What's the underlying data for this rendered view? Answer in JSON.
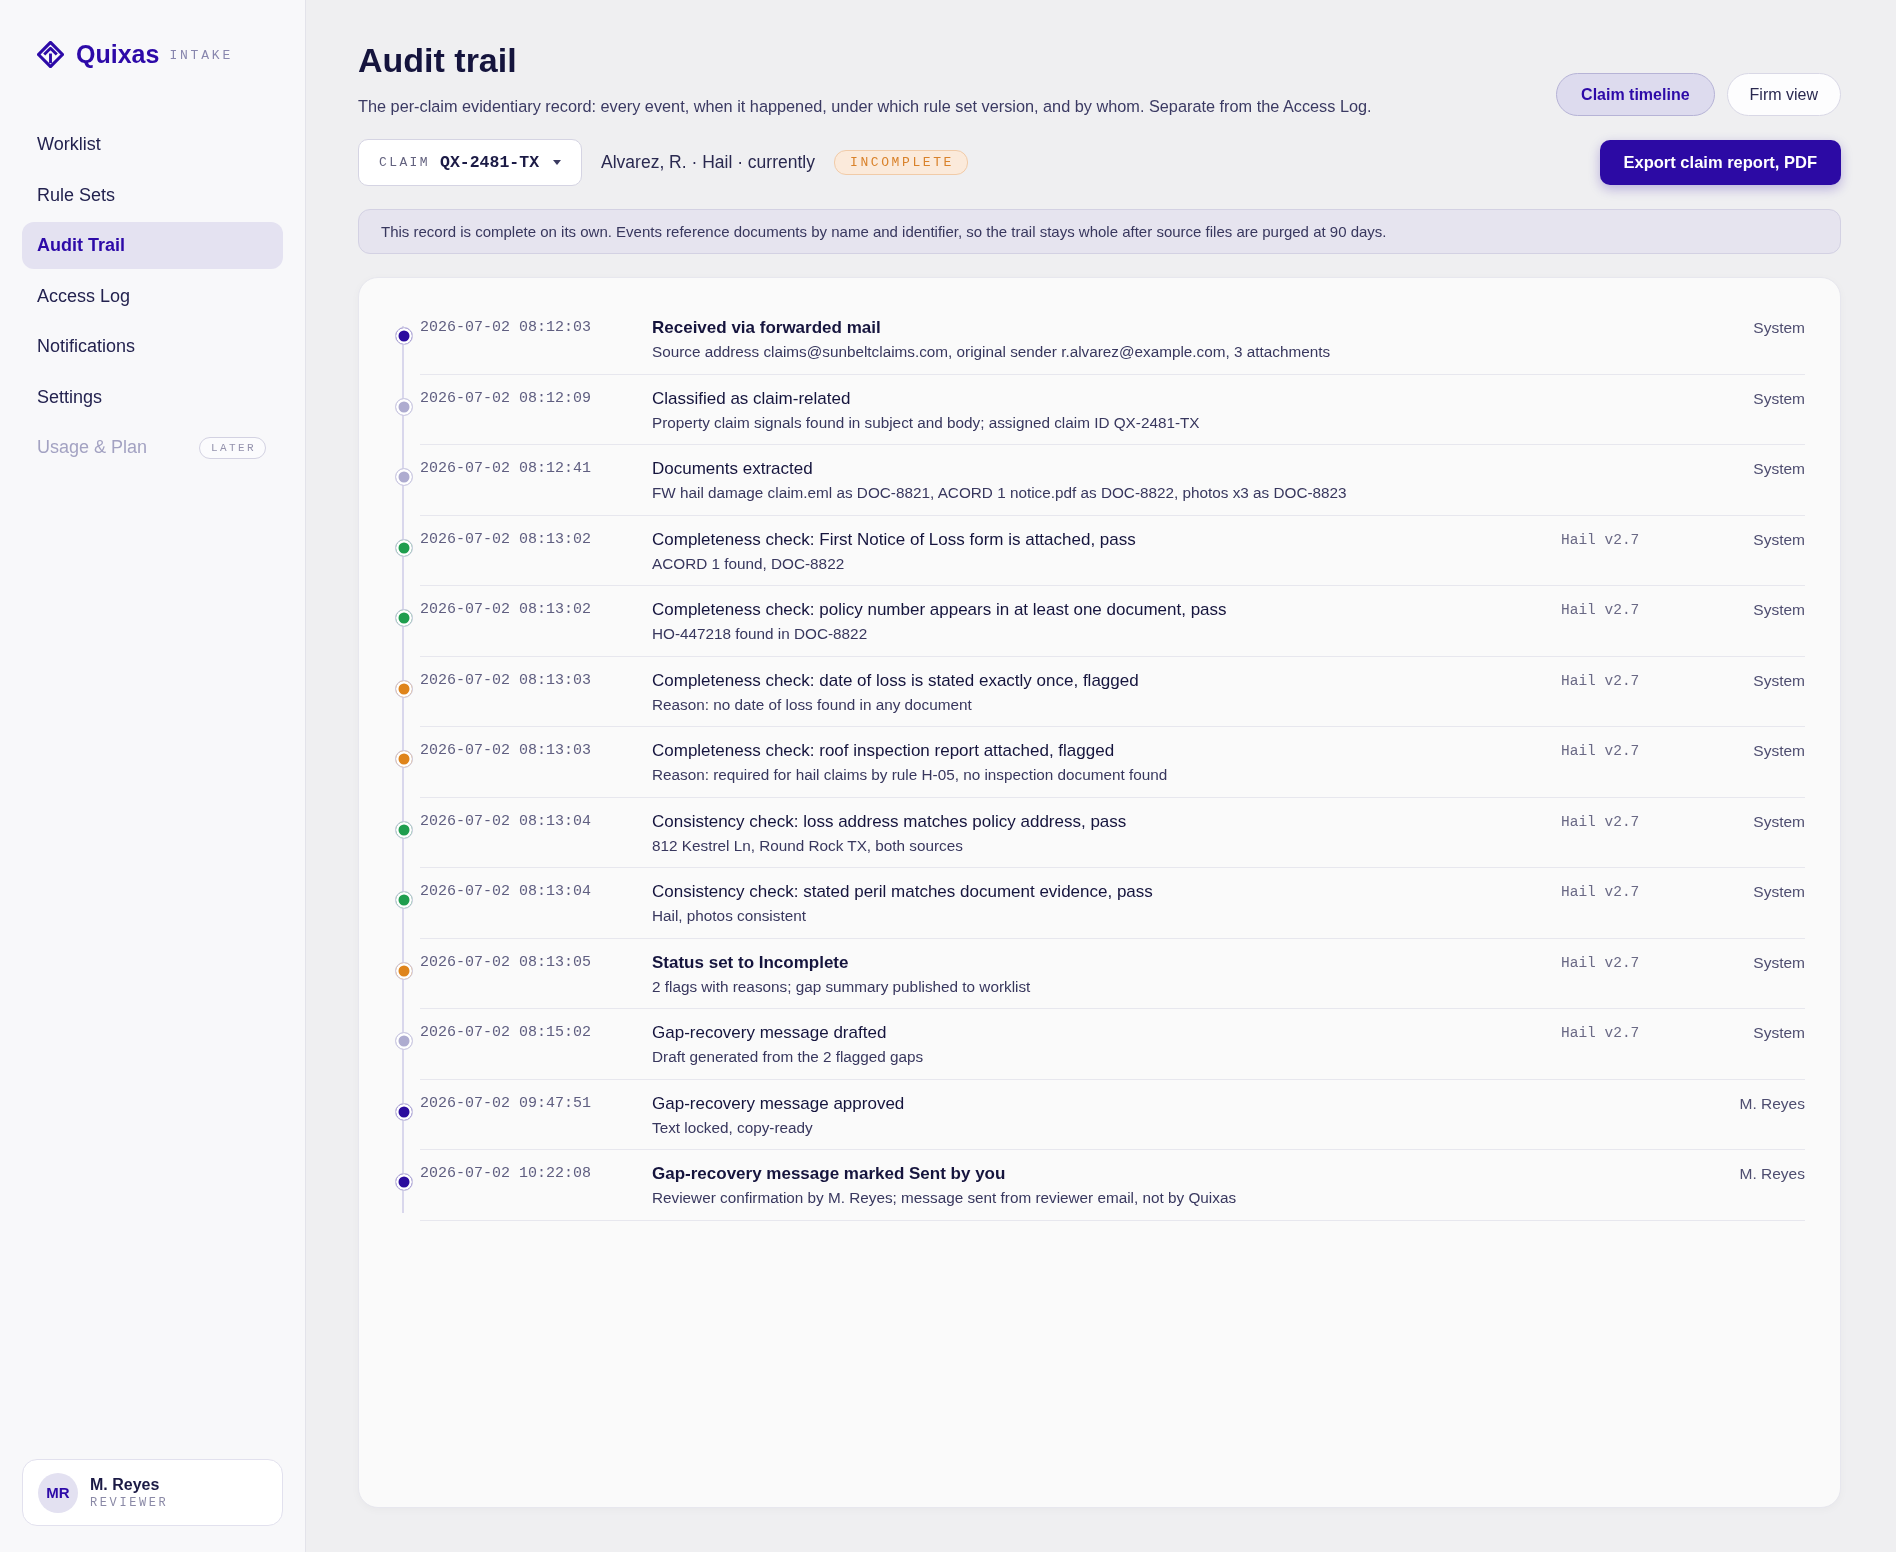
{
  "sidebar": {
    "logo": {
      "name": "Quixas",
      "product": "INTAKE"
    },
    "nav": [
      {
        "label": "Worklist",
        "selected": false,
        "disabled": false
      },
      {
        "label": "Rule Sets",
        "selected": false,
        "disabled": false
      },
      {
        "label": "Audit Trail",
        "selected": true,
        "disabled": false
      },
      {
        "label": "Access Log",
        "selected": false,
        "disabled": false
      },
      {
        "label": "Notifications",
        "selected": false,
        "disabled": false
      },
      {
        "label": "Settings",
        "selected": false,
        "disabled": false
      },
      {
        "label": "Usage & Plan",
        "selected": false,
        "disabled": true,
        "badge": "LATER"
      }
    ],
    "user": {
      "initials": "MR",
      "name": "M. Reyes",
      "role": "REVIEWER"
    }
  },
  "header": {
    "title": "Audit trail",
    "subtitle": "The per-claim evidentiary record: every event, when it happened, under which rule set version, and by whom. Separate from the Access Log.",
    "view_toggle": [
      {
        "label": "Claim timeline",
        "selected": true
      },
      {
        "label": "Firm view",
        "selected": false
      }
    ]
  },
  "claim_bar": {
    "claim_label": "CLAIM",
    "claim_id": "QX-2481-TX",
    "summary": "Alvarez, R. · Hail · currently",
    "status": "INCOMPLETE",
    "export_button": "Export claim report, PDF"
  },
  "notice": "This record is complete on its own. Events reference documents by name and identifier, so the trail stays whole after source files are purged at 90 days.",
  "events": [
    {
      "time": "2026-07-02 08:12:03",
      "title": "Received via forwarded mail",
      "bold": true,
      "detail": "Source address claims@sunbeltclaims.com, original sender r.alvarez@example.com, 3 attachments",
      "actor": "System",
      "color": "#2b0c9e"
    },
    {
      "time": "2026-07-02 08:12:09",
      "title": "Classified as claim-related",
      "bold": false,
      "detail": "Property claim signals found in subject and body; assigned claim ID QX-2481-TX",
      "actor": "System",
      "color": "#aeacd0"
    },
    {
      "time": "2026-07-02 08:12:41",
      "title": "Documents extracted",
      "bold": false,
      "detail": "FW hail damage claim.eml as DOC-8821, ACORD 1 notice.pdf as DOC-8822, photos x3 as DOC-8823",
      "actor": "System",
      "color": "#aeacd0"
    },
    {
      "time": "2026-07-02 08:13:02",
      "title": "Completeness check: First Notice of Loss form is attached, pass",
      "bold": false,
      "detail": "ACORD 1 found, DOC-8822",
      "rule_set": "Hail v2.7",
      "actor": "System",
      "color": "#1f9e4e"
    },
    {
      "time": "2026-07-02 08:13:02",
      "title": "Completeness check: policy number appears in at least one document, pass",
      "bold": false,
      "detail": "HO-447218 found in DOC-8822",
      "rule_set": "Hail v2.7",
      "actor": "System",
      "color": "#1f9e4e"
    },
    {
      "time": "2026-07-02 08:13:03",
      "title": "Completeness check: date of loss is stated exactly once, flagged",
      "bold": false,
      "detail": "Reason: no date of loss found in any document",
      "rule_set": "Hail v2.7",
      "actor": "System",
      "color": "#df841b"
    },
    {
      "time": "2026-07-02 08:13:03",
      "title": "Completeness check: roof inspection report attached, flagged",
      "bold": false,
      "detail": "Reason: required for hail claims by rule H-05, no inspection document found",
      "rule_set": "Hail v2.7",
      "actor": "System",
      "color": "#df841b"
    },
    {
      "time": "2026-07-02 08:13:04",
      "title": "Consistency check: loss address matches policy address, pass",
      "bold": false,
      "detail": "812 Kestrel Ln, Round Rock TX, both sources",
      "rule_set": "Hail v2.7",
      "actor": "System",
      "color": "#1f9e4e"
    },
    {
      "time": "2026-07-02 08:13:04",
      "title": "Consistency check: stated peril matches document evidence, pass",
      "bold": false,
      "detail": "Hail, photos consistent",
      "rule_set": "Hail v2.7",
      "actor": "System",
      "color": "#1f9e4e"
    },
    {
      "time": "2026-07-02 08:13:05",
      "title": "Status set to Incomplete",
      "bold": true,
      "detail": "2 flags with reasons; gap summary published to worklist",
      "rule_set": "Hail v2.7",
      "actor": "System",
      "color": "#df841b"
    },
    {
      "time": "2026-07-02 08:15:02",
      "title": "Gap-recovery message drafted",
      "bold": false,
      "detail": "Draft generated from the 2 flagged gaps",
      "rule_set": "Hail v2.7",
      "actor": "System",
      "color": "#aeacd0"
    },
    {
      "time": "2026-07-02 09:47:51",
      "title": "Gap-recovery message approved",
      "bold": false,
      "detail": "Text locked, copy-ready",
      "actor": "M. Reyes",
      "color": "#2b0c9e"
    },
    {
      "time": "2026-07-02 10:22:08",
      "title": "Gap-recovery message marked Sent by you",
      "bold": true,
      "detail": "Reviewer confirmation by M. Reyes; message sent from reviewer email, not by Quixas",
      "actor": "M. Reyes",
      "color": "#2b0c9e"
    }
  ]
}
